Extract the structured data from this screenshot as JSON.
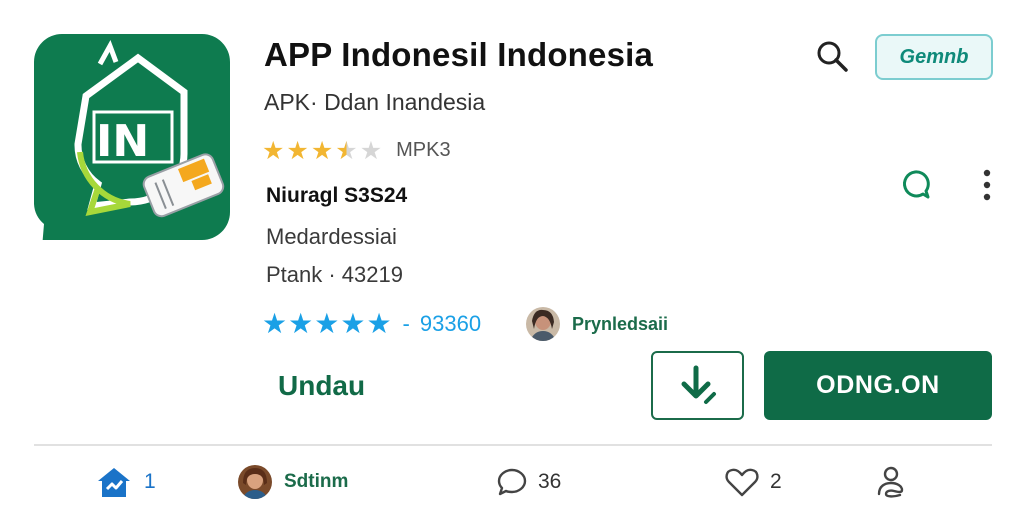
{
  "app": {
    "title": "APP Indonesil Indonesia",
    "subtitle": "APK· Ddan  Inandesia",
    "icon_text": "IN",
    "rating_text": "MPK3",
    "developer": "Niuragl S3S24",
    "category": "Medardessiai",
    "rank": "Ptank · 43219",
    "review_count": "93360",
    "review_dash": "-",
    "publisher_name": "Prynledsaii"
  },
  "ratings": {
    "top_stars": 3.5,
    "top_stars_max": 5,
    "review_stars": 5
  },
  "top": {
    "pill_label": "Gemnb"
  },
  "actions": {
    "secondary_label": "Undau",
    "open_label": "ODNG.ON"
  },
  "bottom_bar": {
    "home_count": "1",
    "user_label": "Sdtinm",
    "comment_count": "36",
    "like_count": "2"
  },
  "colors": {
    "brand_green": "#0f6b47",
    "star_gold": "#f2b632",
    "star_blue": "#1aa0e6",
    "icon_bg": "#0e7b4f"
  },
  "icons": [
    "search-icon",
    "chat-bubble-icon",
    "more-vertical-icon",
    "download-icon",
    "home-icon",
    "comment-icon",
    "heart-icon",
    "profile-icon",
    "star-icon"
  ]
}
